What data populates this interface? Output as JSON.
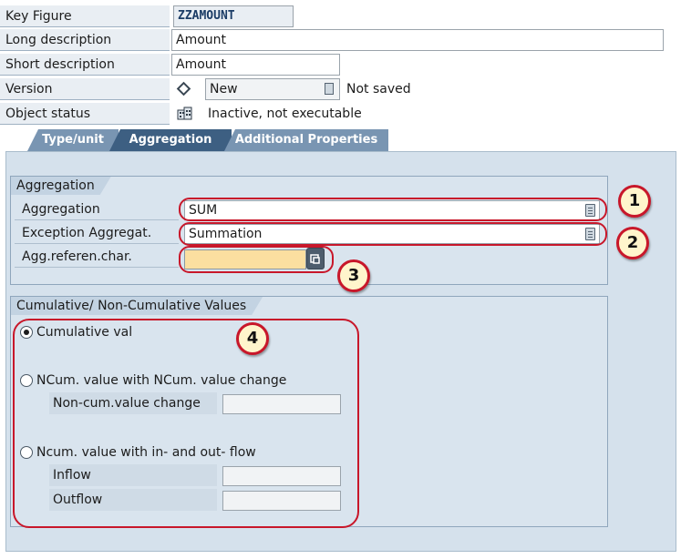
{
  "header": {
    "key_figure_label": "Key Figure",
    "key_figure_value": "ZZAMOUNT",
    "long_desc_label": "Long description",
    "long_desc_value": "Amount",
    "short_desc_label": "Short description",
    "short_desc_value": "Amount",
    "version_label": "Version",
    "version_icon": "diamond-icon",
    "version_value": "New",
    "version_status": "Not saved",
    "object_status_label": "Object status",
    "object_status_icon": "building-icon",
    "object_status_value": "Inactive, not executable"
  },
  "tabs": [
    {
      "label": "Type/unit",
      "active": false
    },
    {
      "label": "Aggregation",
      "active": true
    },
    {
      "label": "Additional Properties",
      "active": false
    }
  ],
  "aggregation_group": {
    "title": "Aggregation",
    "aggregation_label": "Aggregation",
    "aggregation_value": "SUM",
    "exception_label": "Exception Aggregat.",
    "exception_value": "Summation",
    "ref_char_label": "Agg.referen.char.",
    "ref_char_value": ""
  },
  "cumulative_group": {
    "title": "Cumulative/ Non-Cumulative Values",
    "options": [
      {
        "label": "Cumulative val",
        "selected": true
      },
      {
        "label": "NCum. value with NCum. value change",
        "selected": false
      },
      {
        "label": "Ncum. value with in- and out- flow",
        "selected": false
      }
    ],
    "noncum_change_label": "Non-cum.value change",
    "noncum_change_value": "",
    "inflow_label": "Inflow",
    "inflow_value": "",
    "outflow_label": "Outflow",
    "outflow_value": ""
  },
  "annotations": {
    "badge1": "1",
    "badge2": "2",
    "badge3": "3",
    "badge4": "4",
    "highlight_color": "#c8172a"
  },
  "colors": {
    "tab_active": "#3d5f82",
    "tab_inactive": "#7995b2",
    "panel_bg": "#d5e1ec",
    "required_field": "#fbdfa0"
  }
}
